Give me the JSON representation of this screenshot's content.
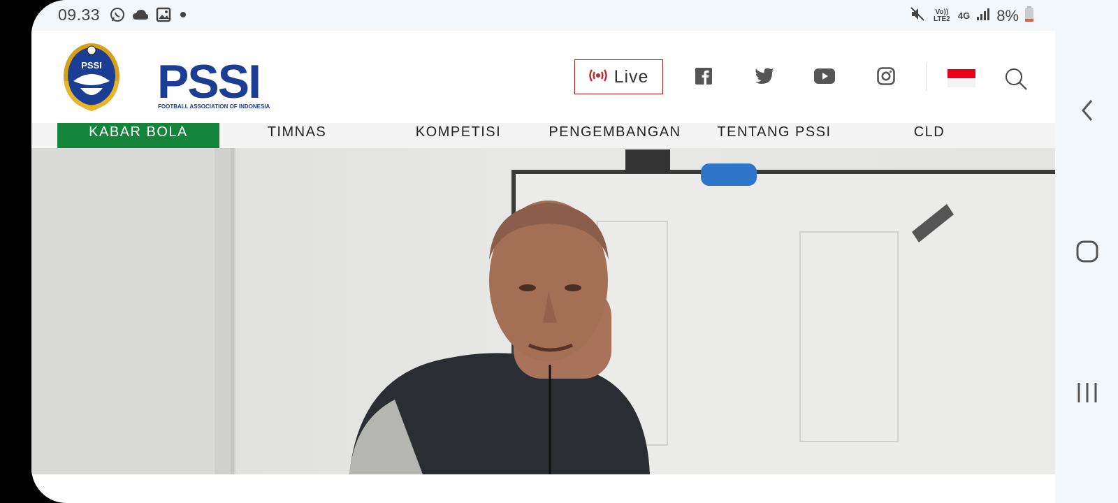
{
  "status_bar": {
    "time": "09.33",
    "left_icons": [
      "whatsapp-icon",
      "cloud-icon",
      "image-icon",
      "dot-icon"
    ],
    "network_volte": "Vo)) LTE2",
    "network_type": "4G",
    "battery": "8%"
  },
  "header": {
    "logo_text": "PSSI",
    "logo_subtitle": "FOOTBALL ASSOCIATION OF INDONESIA",
    "logo_emblem_text": "PSSI",
    "live_label": "Live",
    "social_icons": [
      "facebook-icon",
      "twitter-icon",
      "youtube-icon",
      "instagram-icon"
    ],
    "language_flag": "indonesia-flag",
    "accent_color": "#1c3d94",
    "live_color": "#c62828"
  },
  "nav": {
    "items": [
      {
        "label": "KABAR BOLA",
        "active": true
      },
      {
        "label": "TIMNAS",
        "active": false
      },
      {
        "label": "KOMPETISI",
        "active": false
      },
      {
        "label": "PENGEMBANGAN",
        "active": false
      },
      {
        "label": "TENTANG PSSI",
        "active": false
      },
      {
        "label": "CLD",
        "active": false
      }
    ],
    "active_color": "#14843a"
  },
  "hero": {
    "image_subject": "coach-photo"
  },
  "system_nav": {
    "buttons": [
      "back-icon",
      "home-icon",
      "recents-icon"
    ]
  }
}
